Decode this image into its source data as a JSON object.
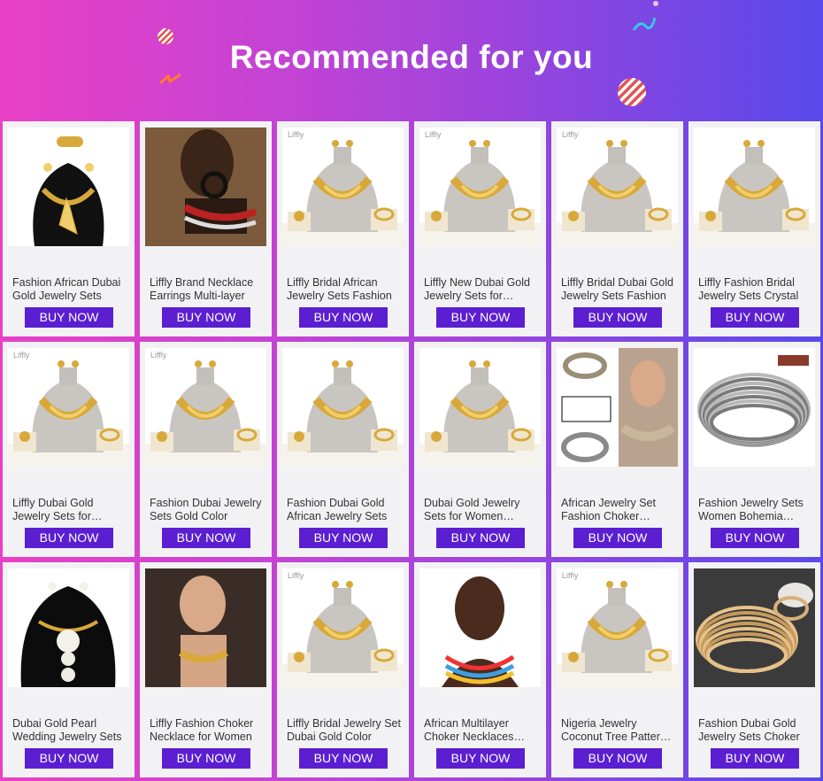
{
  "header": {
    "title": "Recommended for you"
  },
  "colors": {
    "buy_button": "#5b1fd1",
    "card_bg": "#f2f2f4",
    "banner_start": "#e940c6",
    "banner_end": "#5a48ea"
  },
  "products": [
    {
      "name": "Fashion African Dubai Gold Jewelry Sets",
      "button": "BUY NOW",
      "watermark": "",
      "style": "black-bust"
    },
    {
      "name": "Liffly Brand Necklace Earrings Multi-layer",
      "button": "BUY NOW",
      "watermark": "",
      "style": "photo-brown"
    },
    {
      "name": "Liffly Bridal African Jewelry Sets Fashion",
      "button": "BUY NOW",
      "watermark": "Liffly",
      "style": "gray-bust"
    },
    {
      "name": "Liffly New Dubai Gold Jewelry Sets for Women",
      "button": "BUY NOW",
      "watermark": "Liffly",
      "style": "gray-bust"
    },
    {
      "name": "Liffly Bridal Dubai Gold Jewelry Sets Fashion",
      "button": "BUY NOW",
      "watermark": "Liffly",
      "style": "gray-bust"
    },
    {
      "name": "Liffly Fashion Bridal Jewelry Sets Crystal",
      "button": "BUY NOW",
      "watermark": "",
      "style": "gray-bust"
    },
    {
      "name": "Liffly Dubai Gold Jewelry Sets for Women",
      "button": "BUY NOW",
      "watermark": "Liffly",
      "style": "gray-bust"
    },
    {
      "name": "Fashion Dubai Jewelry Sets Gold Color",
      "button": "BUY NOW",
      "watermark": "Liffly",
      "style": "gray-bust"
    },
    {
      "name": "Fashion Dubai Gold African Jewelry Sets",
      "button": "BUY NOW",
      "watermark": "",
      "style": "gray-bust"
    },
    {
      "name": "Dubai Gold Jewelry Sets for Women Wedding",
      "button": "BUY NOW",
      "watermark": "",
      "style": "gray-bust"
    },
    {
      "name": "African Jewelry Set Fashion Choker Necklace",
      "button": "BUY NOW",
      "watermark": "",
      "style": "photo-choker"
    },
    {
      "name": "Fashion Jewelry Sets Women Bohemia Necklace",
      "button": "BUY NOW",
      "watermark": "",
      "style": "silver-coil"
    },
    {
      "name": "Dubai Gold Pearl Wedding Jewelry Sets",
      "button": "BUY NOW",
      "watermark": "",
      "style": "black-pearl"
    },
    {
      "name": "Liffly Fashion Choker Necklace for Women",
      "button": "BUY NOW",
      "watermark": "",
      "style": "photo-choker2"
    },
    {
      "name": "Liffly Bridal Jewelry Set Dubai Gold Color",
      "button": "BUY NOW",
      "watermark": "Liffly",
      "style": "gray-bust"
    },
    {
      "name": "African Multilayer Choker Necklaces Beads",
      "button": "BUY NOW",
      "watermark": "",
      "style": "photo-beads"
    },
    {
      "name": "Nigeria Jewelry Coconut Tree Pattern Sets",
      "button": "BUY NOW",
      "watermark": "Liffly",
      "style": "gray-bust"
    },
    {
      "name": "Fashion Dubai Gold Jewelry Sets Choker",
      "button": "BUY NOW",
      "watermark": "",
      "style": "gold-coil"
    }
  ]
}
